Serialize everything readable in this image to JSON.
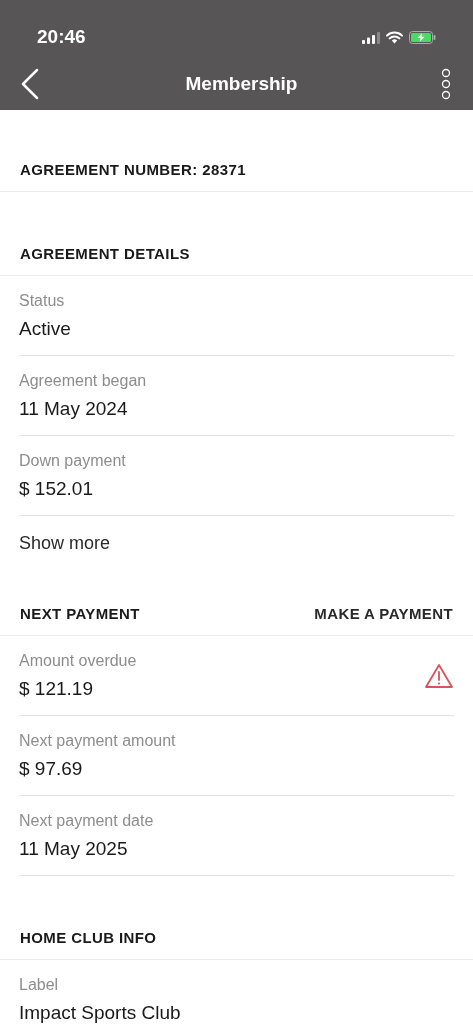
{
  "status_bar": {
    "time": "20:46"
  },
  "header": {
    "title": "Membership"
  },
  "sections": [
    {
      "title": "AGREEMENT NUMBER: 28371"
    },
    {
      "title": "AGREEMENT DETAILS",
      "rows": [
        {
          "label": "Status",
          "value": "Active",
          "alert": false
        },
        {
          "label": "Agreement began",
          "value": "11 May 2024",
          "alert": false
        },
        {
          "label": "Down payment",
          "value": "$ 152.01",
          "alert": false
        }
      ],
      "footer_link": "Show more"
    },
    {
      "title": "NEXT PAYMENT",
      "action": "MAKE A PAYMENT",
      "rows": [
        {
          "label": "Amount overdue",
          "value": "$ 121.19",
          "alert": true
        },
        {
          "label": "Next payment amount",
          "value": "$ 97.69",
          "alert": false
        },
        {
          "label": "Next payment date",
          "value": "11 May 2025",
          "alert": false
        }
      ]
    },
    {
      "title": "HOME CLUB INFO",
      "rows": [
        {
          "label": "Label",
          "value": "Impact Sports Club",
          "alert": false
        }
      ]
    }
  ]
}
